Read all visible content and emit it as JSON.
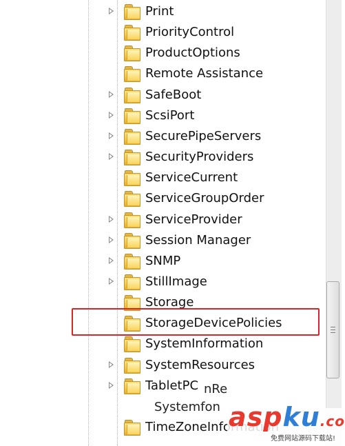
{
  "tree": {
    "items": [
      {
        "label": "Print",
        "expandable": true
      },
      {
        "label": "PriorityControl",
        "expandable": false
      },
      {
        "label": "ProductOptions",
        "expandable": false
      },
      {
        "label": "Remote Assistance",
        "expandable": false
      },
      {
        "label": "SafeBoot",
        "expandable": true
      },
      {
        "label": "ScsiPort",
        "expandable": true
      },
      {
        "label": "SecurePipeServers",
        "expandable": true
      },
      {
        "label": "SecurityProviders",
        "expandable": true
      },
      {
        "label": "ServiceCurrent",
        "expandable": false
      },
      {
        "label": "ServiceGroupOrder",
        "expandable": false
      },
      {
        "label": "ServiceProvider",
        "expandable": true
      },
      {
        "label": "Session Manager",
        "expandable": true
      },
      {
        "label": "SNMP",
        "expandable": true
      },
      {
        "label": "StillImage",
        "expandable": true
      },
      {
        "label": "Storage",
        "expandable": false
      },
      {
        "label": "StorageDevicePolicies",
        "expandable": false,
        "highlighted": true
      },
      {
        "label": "SystemInformation",
        "expandable": false
      },
      {
        "label": "SystemResources",
        "expandable": true
      },
      {
        "label": "TabletPC",
        "expandable": true
      },
      {
        "label": "",
        "expandable": false
      },
      {
        "label": "TimeZoneInformation",
        "expandable": false
      }
    ],
    "partial_overlays": [
      {
        "text": "nRe"
      },
      {
        "text": "Systemfon"
      }
    ]
  },
  "highlight_color": "#d62528",
  "watermark": {
    "brand_asp": "asp",
    "brand_ku": "ku",
    "brand_tld": ".com",
    "tagline": "免费网站源码下载站!",
    "asp_color": "#e8392f",
    "ku_color": "#2f7fd6"
  }
}
